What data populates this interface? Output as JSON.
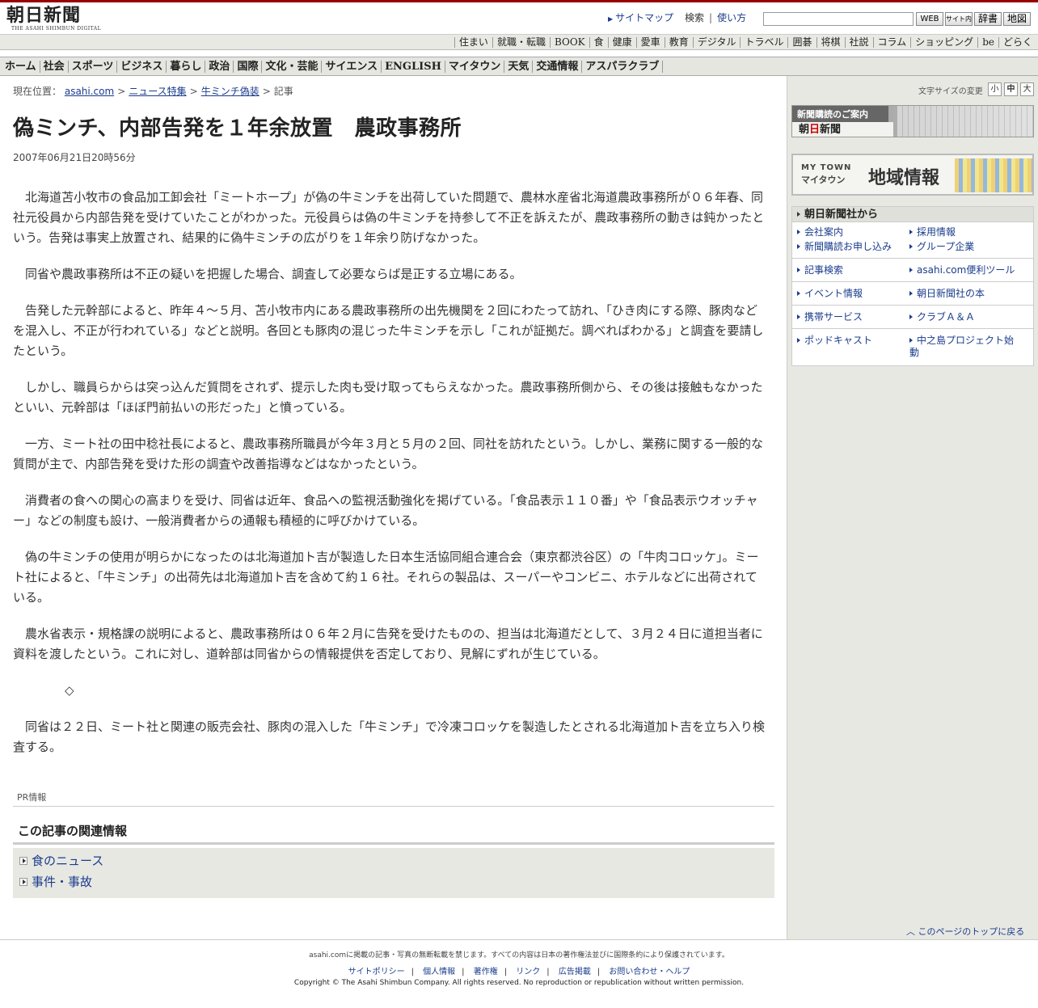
{
  "header": {
    "logo_jp": "朝日新聞",
    "logo_en": "THE ASAHI SHIMBUN DIGITAL",
    "links": {
      "sitemap": "サイトマップ",
      "search": "検索",
      "howto": "使い方"
    },
    "search": {
      "placeholder": ""
    },
    "buttons": [
      "WEB",
      "サイト内",
      "辞書",
      "地図"
    ]
  },
  "category_bar": [
    "住まい",
    "就職・転職",
    "BOOK",
    "食",
    "健康",
    "愛車",
    "教育",
    "デジタル",
    "トラベル",
    "囲碁",
    "将棋",
    "社説",
    "コラム",
    "ショッピング",
    "be",
    "どらく"
  ],
  "main_nav": [
    "ホーム",
    "社会",
    "スポーツ",
    "ビジネス",
    "暮らし",
    "政治",
    "国際",
    "文化・芸能",
    "サイエンス",
    "ENGLISH",
    "マイタウン",
    "天気",
    "交通情報",
    "アスパラクラブ"
  ],
  "breadcrumb": {
    "label": "現在位置：",
    "items": [
      "asahi.com",
      "ニュース特集",
      "牛ミンチ偽装"
    ],
    "current": "記事"
  },
  "article": {
    "title": "偽ミンチ、内部告発を１年余放置　農政事務所",
    "date": "2007年06月21日20時56分",
    "paragraphs": [
      "北海道苫小牧市の食品加工卸会社「ミートホープ」が偽の牛ミンチを出荷していた問題で、農林水産省北海道農政事務所が０６年春、同社元役員から内部告発を受けていたことがわかった。元役員らは偽の牛ミンチを持参して不正を訴えたが、農政事務所の動きは鈍かったという。告発は事実上放置され、結果的に偽牛ミンチの広がりを１年余り防げなかった。",
      "同省や農政事務所は不正の疑いを把握した場合、調査して必要ならば是正する立場にある。",
      "告発した元幹部によると、昨年４～５月、苫小牧市内にある農政事務所の出先機関を２回にわたって訪れ、「ひき肉にする際、豚肉などを混入し、不正が行われている」などと説明。各回とも豚肉の混じった牛ミンチを示し「これが証拠だ。調べればわかる」と調査を要請したという。",
      "しかし、職員らからは突っ込んだ質問をされず、提示した肉も受け取ってもらえなかった。農政事務所側から、その後は接触もなかったといい、元幹部は「ほぼ門前払いの形だった」と憤っている。",
      "一方、ミート社の田中稔社長によると、農政事務所職員が今年３月と５月の２回、同社を訪れたという。しかし、業務に関する一般的な質問が主で、内部告発を受けた形の調査や改善指導などはなかったという。",
      "消費者の食への関心の高まりを受け、同省は近年、食品への監視活動強化を掲げている。「食品表示１１０番」や「食品表示ウオッチャー」などの制度も設け、一般消費者からの通報も積極的に呼びかけている。",
      "偽の牛ミンチの使用が明らかになったのは北海道加ト吉が製造した日本生活協同組合連合会（東京都渋谷区）の「牛肉コロッケ」。ミート社によると、「牛ミンチ」の出荷先は北海道加ト吉を含めて約１６社。それらの製品は、スーパーやコンビニ、ホテルなどに出荷されている。",
      "農水省表示・規格課の説明によると、農政事務所は０６年２月に告発を受けたものの、担当は北海道だとして、３月２４日に道担当者に資料を渡したという。これに対し、道幹部は同省からの情報提供を否定しており、見解にずれが生じている。",
      "◇",
      "同省は２２日、ミート社と関連の販売会社、豚肉の混入した「牛ミンチ」で冷凍コロッケを製造したとされる北海道加ト吉を立ち入り検査する。"
    ]
  },
  "pr_label": "PR情報",
  "related": {
    "heading": "この記事の関連情報",
    "items": [
      "食のニュース",
      "事件・事故"
    ]
  },
  "sidebar": {
    "font_size_label": "文字サイズの変更",
    "font_sizes": [
      "小",
      "中",
      "大"
    ],
    "banner1_top": "新聞購読のご案内",
    "banner1_logo_a": "朝",
    "banner1_logo_b": "日",
    "banner1_logo_c": "新聞",
    "banner2_en1": "MY TOWN",
    "banner2_en2": "マイタウン",
    "banner2_big": "地域情報",
    "company_heading": "朝日新聞社から",
    "company_links": [
      "会社案内",
      "採用情報",
      "新聞購読お申し込み",
      "グループ企業",
      "記事検索",
      "asahi.com便利ツール",
      "イベント情報",
      "朝日新聞社の本",
      "携帯サービス",
      "クラブＡ＆Ａ",
      "ポッドキャスト",
      "中之島プロジェクト始動"
    ],
    "page_top": "このページのトップに戻る"
  },
  "footer": {
    "notice": "asahi.comに掲載の記事・写真の無断転載を禁じます。すべての内容は日本の著作権法並びに国際条約により保護されています。",
    "links": [
      "サイトポリシー",
      "個人情報",
      "著作権",
      "リンク",
      "広告掲載",
      "お問い合わせ・ヘルプ"
    ],
    "copyright": "Copyright © The Asahi Shimbun Company. All rights reserved. No reproduction or republication without written permission."
  }
}
